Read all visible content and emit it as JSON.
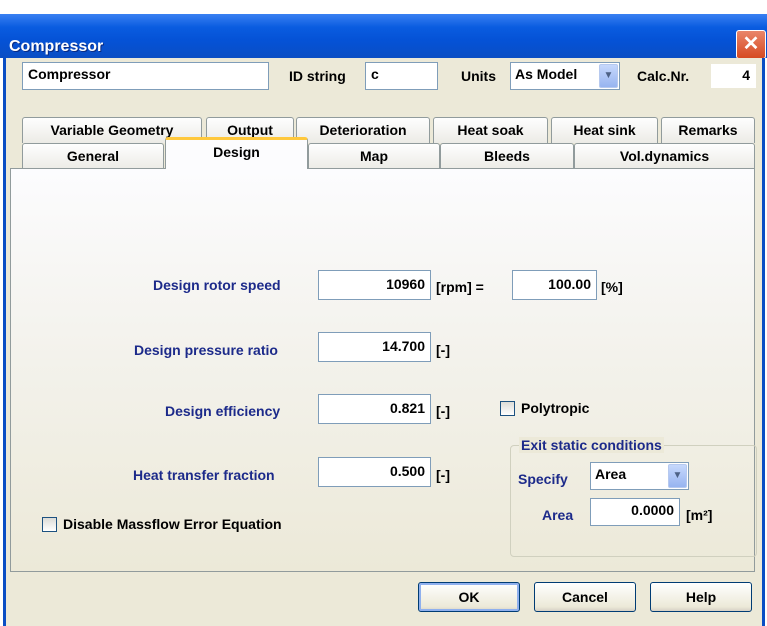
{
  "window": {
    "title": "Compressor",
    "close_glyph": "✕"
  },
  "header": {
    "name_value": "Compressor",
    "id_label": "ID string",
    "id_value": "c",
    "units_label": "Units",
    "units_value": "As Model",
    "calc_label": "Calc.Nr.",
    "calc_value": "4"
  },
  "tabs_row1": [
    "Variable Geometry",
    "Output",
    "Deterioration",
    "Heat soak",
    "Heat sink",
    "Remarks"
  ],
  "tabs_row2": [
    "General",
    "Design",
    "Map",
    "Bleeds",
    "Vol.dynamics"
  ],
  "selected_tab": "Design",
  "design": {
    "rotor_speed_label": "Design rotor speed",
    "rotor_speed_value": "10960",
    "rotor_speed_unit": "[rpm] =",
    "rotor_speed_pct_value": "100.00",
    "rotor_speed_pct_unit": "[%]",
    "pressure_ratio_label": "Design pressure ratio",
    "pressure_ratio_value": "14.700",
    "pressure_ratio_unit": "[-]",
    "efficiency_label": "Design efficiency",
    "efficiency_value": "0.821",
    "efficiency_unit": "[-]",
    "polytropic_label": "Polytropic",
    "polytropic_checked": false,
    "heat_transfer_label": "Heat transfer fraction",
    "heat_transfer_value": "0.500",
    "heat_transfer_unit": "[-]",
    "disable_massflow_label": "Disable Massflow Error Equation",
    "disable_massflow_checked": false
  },
  "exit_static": {
    "group_title": "Exit static conditions",
    "specify_label": "Specify",
    "specify_value": "Area",
    "area_label": "Area",
    "area_value": "0.0000",
    "area_unit": "[m²]"
  },
  "buttons": {
    "ok": "OK",
    "cancel": "Cancel",
    "help": "Help"
  },
  "colors": {
    "titlebar": "#0552d6",
    "face": "#ece9d8",
    "tab_highlight": "#ffc83c",
    "label_blue": "#1c2a8a"
  }
}
